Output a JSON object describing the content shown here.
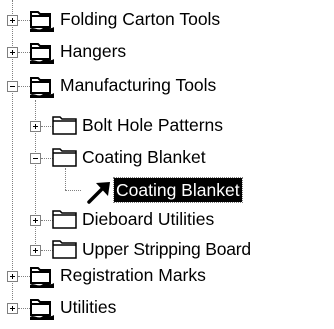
{
  "tree": {
    "nodes": [
      {
        "key": "folding-carton-tools",
        "label": "Folding Carton Tools",
        "icon": "network-folder-icon",
        "expander": "collapsed"
      },
      {
        "key": "hangers",
        "label": "Hangers",
        "icon": "network-folder-icon",
        "expander": "collapsed"
      },
      {
        "key": "manufacturing-tools",
        "label": "Manufacturing Tools",
        "icon": "network-folder-icon",
        "expander": "expanded"
      },
      {
        "key": "bolt-hole-patterns",
        "label": "Bolt Hole Patterns",
        "icon": "folder-icon",
        "expander": "collapsed"
      },
      {
        "key": "coating-blanket-folder",
        "label": "Coating Blanket",
        "icon": "folder-icon",
        "expander": "expanded"
      },
      {
        "key": "coating-blanket-tool",
        "label": "Coating Blanket",
        "icon": "tool-arrow-icon",
        "expander": "none",
        "selected": true
      },
      {
        "key": "dieboard-utilities",
        "label": "Dieboard Utilities",
        "icon": "folder-icon",
        "expander": "collapsed"
      },
      {
        "key": "upper-stripping-board",
        "label": "Upper Stripping Board",
        "icon": "folder-icon",
        "expander": "collapsed"
      },
      {
        "key": "registration-marks",
        "label": "Registration Marks",
        "icon": "network-folder-icon",
        "expander": "collapsed"
      },
      {
        "key": "utilities",
        "label": "Utilities",
        "icon": "network-folder-icon",
        "expander": "collapsed"
      }
    ]
  }
}
